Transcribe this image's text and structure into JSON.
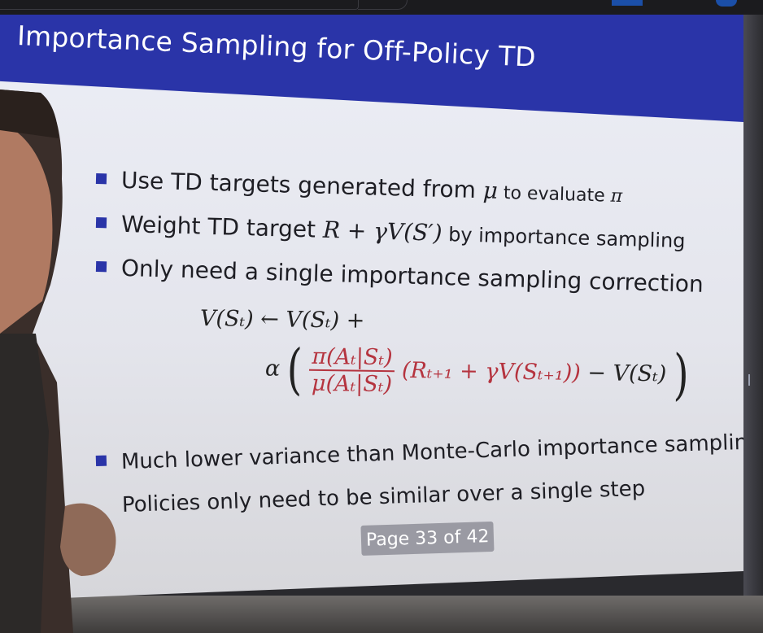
{
  "slide": {
    "title": "Importance Sampling for Off-Policy TD",
    "bullets": [
      {
        "text_a": "Use TD targets generated from ",
        "m1": "μ",
        "text_b": " to evaluate ",
        "m2": "π"
      },
      {
        "text_a": "Weight TD target ",
        "m1": "R + γV(S′)",
        "text_b": " by importance sampling"
      },
      {
        "text_a": "Only need a single importance sampling correction"
      },
      {
        "text_a": "Much lower variance than Monte-Carlo importance sampling"
      },
      {
        "text_a": "Policies only need to be similar over a single step"
      }
    ],
    "equation": {
      "line1": "V(Sₜ) ← V(Sₜ) +",
      "alpha": "α",
      "frac_num": "π(Aₜ|Sₜ)",
      "frac_den": "μ(Aₜ|Sₜ)",
      "target": "(Rₜ₊₁ + γV(Sₜ₊₁))",
      "minus": " − V(Sₜ)"
    },
    "pager": "Page 33 of 42"
  },
  "colors": {
    "title_bar": "#2a34a8",
    "bullet_square": "#2a34a8",
    "equation_red": "#b5343f",
    "pager_bg": "#9a9aa3"
  }
}
